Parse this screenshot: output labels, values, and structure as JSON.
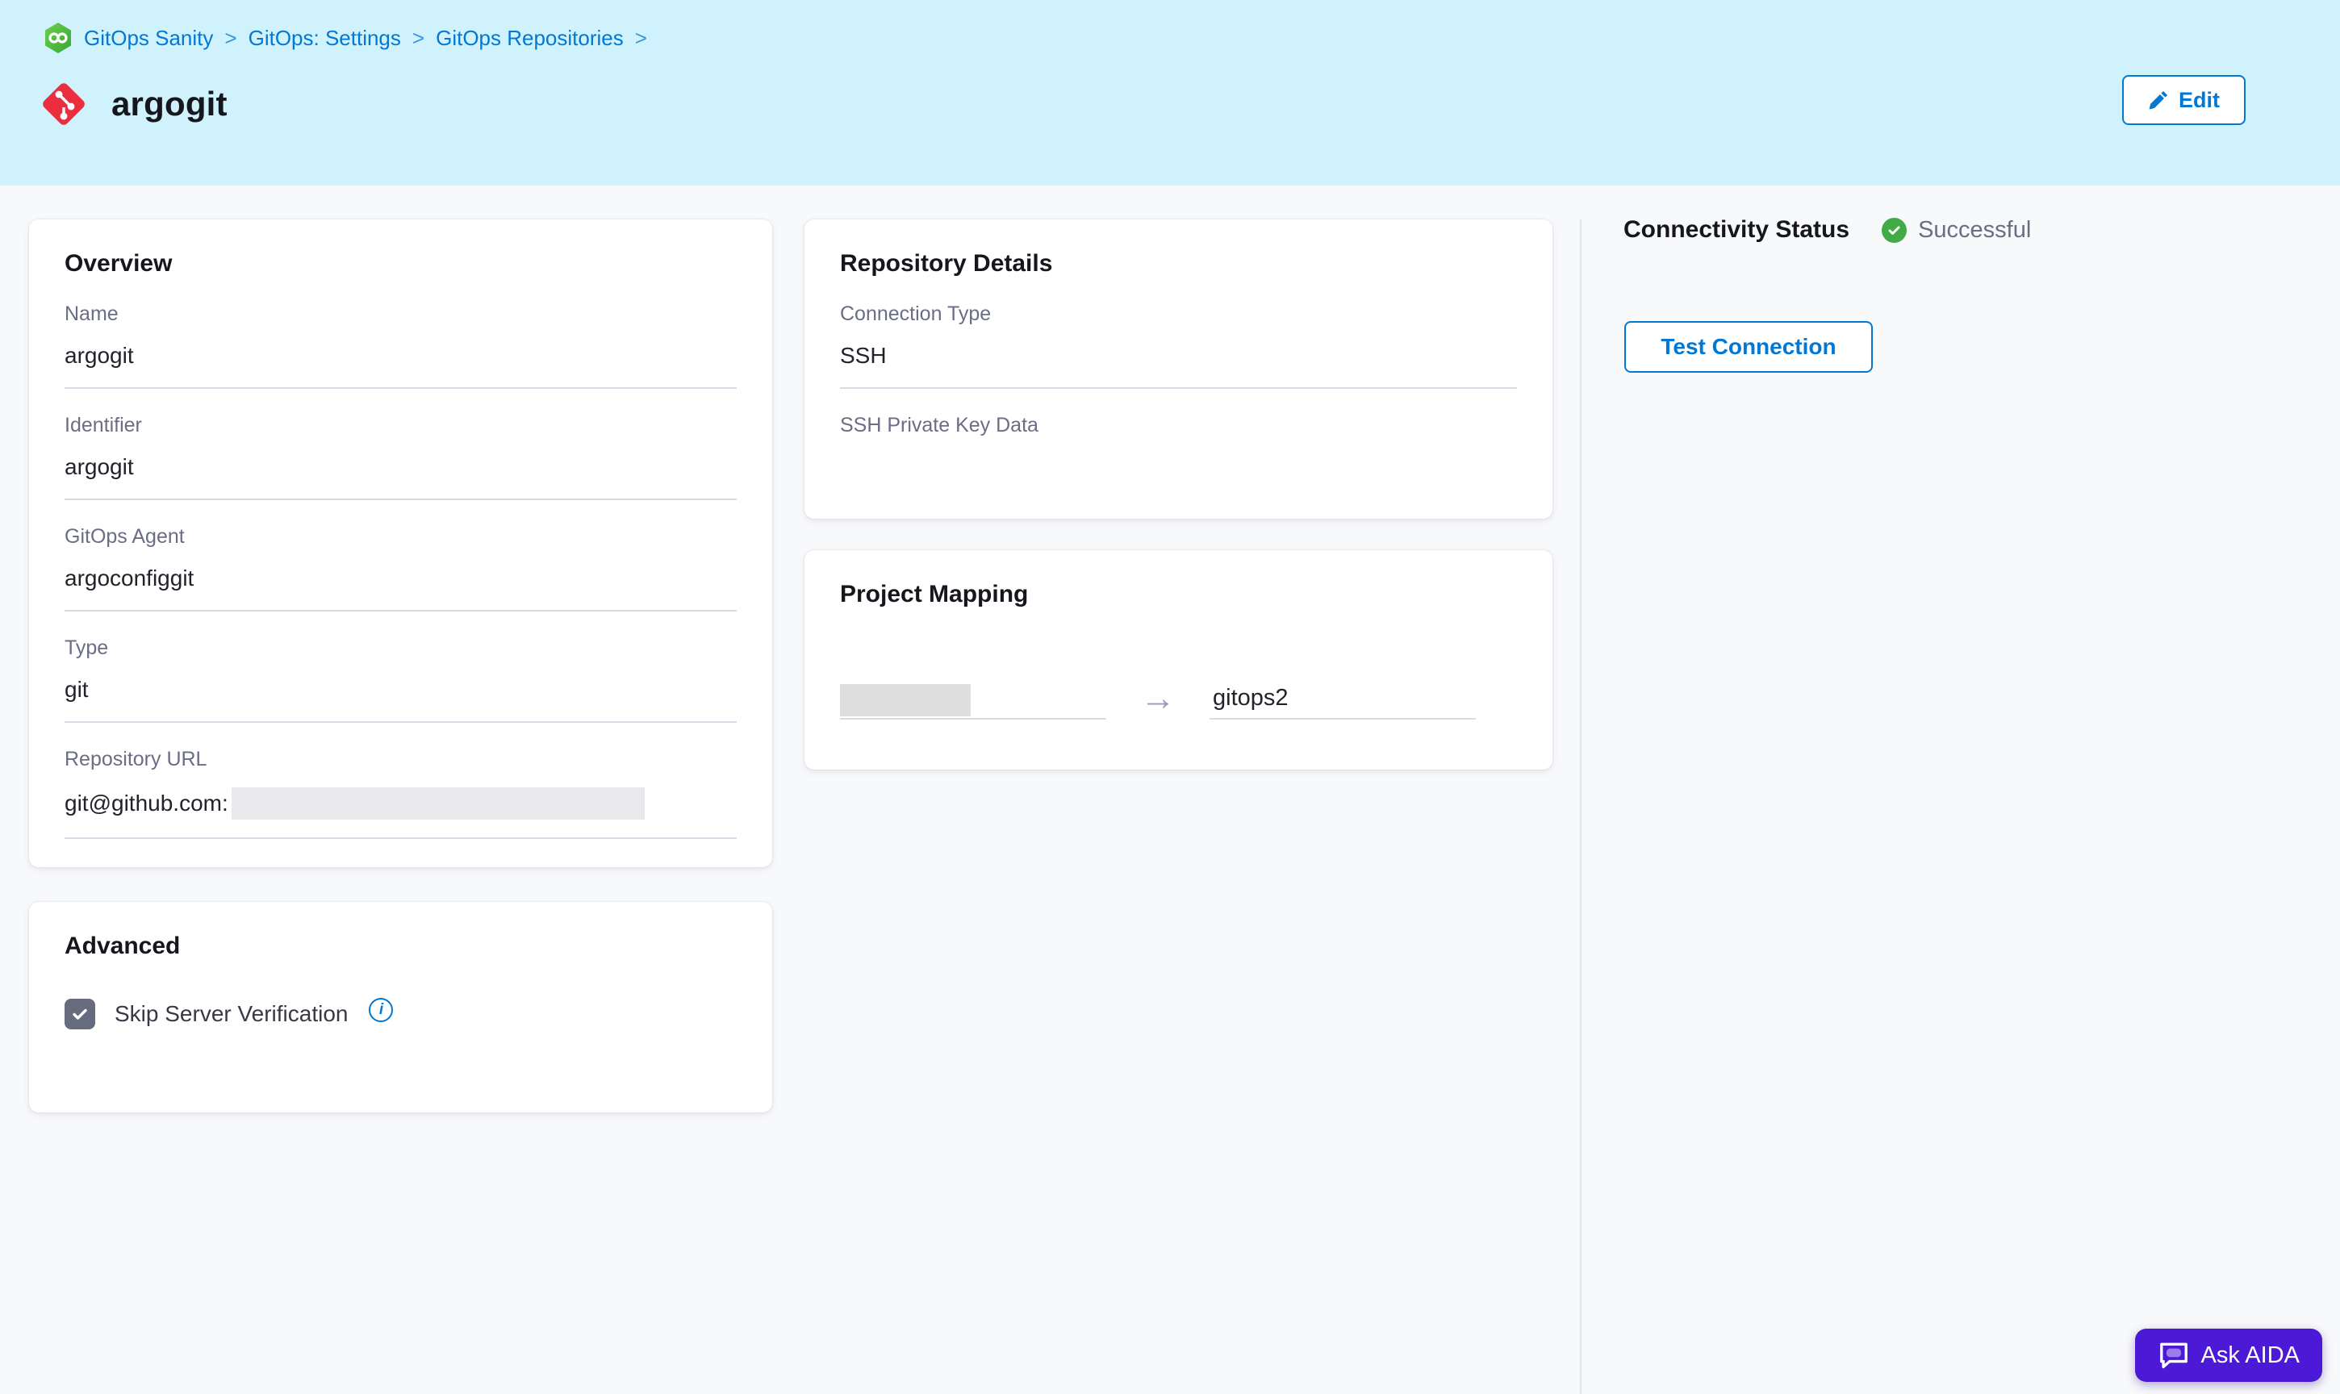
{
  "breadcrumb": {
    "items": [
      "GitOps Sanity",
      "GitOps: Settings",
      "GitOps Repositories"
    ],
    "separator": ">"
  },
  "header": {
    "title": "argogit",
    "edit_label": "Edit"
  },
  "cards": {
    "overview": {
      "title": "Overview",
      "fields": [
        {
          "label": "Name",
          "value": "argogit"
        },
        {
          "label": "Identifier",
          "value": "argogit"
        },
        {
          "label": "GitOps Agent",
          "value": "argoconfiggit"
        },
        {
          "label": "Type",
          "value": "git"
        },
        {
          "label": "Repository URL",
          "value": "git@github.com:",
          "redacted": true
        }
      ]
    },
    "repository_details": {
      "title": "Repository Details",
      "fields": [
        {
          "label": "Connection Type",
          "value": "SSH"
        },
        {
          "label": "SSH Private Key Data",
          "value": ""
        }
      ]
    },
    "project_mapping": {
      "title": "Project Mapping",
      "source_redacted": true,
      "arrow": "→",
      "target": "gitops2"
    },
    "advanced": {
      "title": "Advanced",
      "checkbox_label": "Skip Server Verification",
      "checked": true,
      "info_glyph": "i"
    }
  },
  "connectivity": {
    "title": "Connectivity Status",
    "status": "Successful",
    "test_button_label": "Test Connection"
  },
  "aida": {
    "label": "Ask AIDA"
  },
  "colors": {
    "accent_blue": "#0278D5",
    "header_bg": "#CFF2FC",
    "success_green": "#42AB45",
    "aida_purple": "#4C1AD6",
    "label_gray": "#6B6D85",
    "git_red": "#EA2E40",
    "gitops_green": "#4CBF45"
  }
}
